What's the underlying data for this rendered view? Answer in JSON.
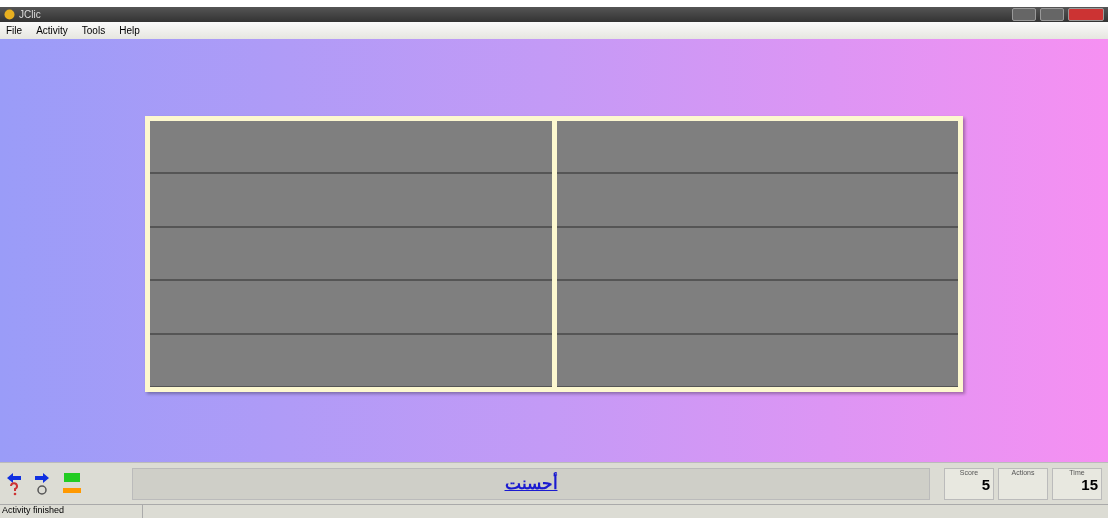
{
  "window": {
    "title": "JClic"
  },
  "menu": [
    "File",
    "Activity",
    "Tools",
    "Help"
  ],
  "board": {
    "columns": [
      {
        "cells": [
          {
            "kind": "blank"
          },
          {
            "kind": "blank"
          },
          {
            "kind": "blank"
          },
          {
            "kind": "blank"
          },
          {
            "kind": "blank"
          }
        ]
      },
      {
        "cells": [
          {
            "kind": "blank"
          },
          {
            "kind": "blank"
          },
          {
            "kind": "blank"
          },
          {
            "kind": "blank"
          },
          {
            "kind": "blank"
          }
        ]
      }
    ]
  },
  "message": "أحسنت",
  "counters": [
    {
      "label": "Score",
      "value": "5"
    },
    {
      "label": "Actions"
    },
    {
      "label": "Time",
      "value": "15"
    }
  ],
  "status_bar": "Activity finished"
}
